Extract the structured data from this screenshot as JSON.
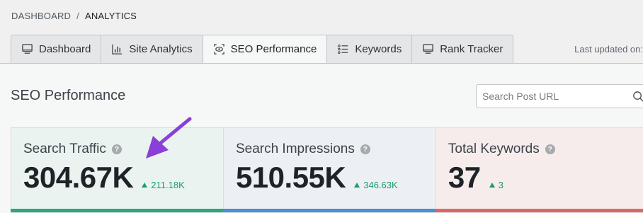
{
  "breadcrumb": {
    "root": "DASHBOARD",
    "separator": "/",
    "current": "ANALYTICS"
  },
  "tabs": [
    {
      "label": "Dashboard",
      "icon": "monitor-icon",
      "active": false
    },
    {
      "label": "Site Analytics",
      "icon": "bar-chart-icon",
      "active": false
    },
    {
      "label": "SEO Performance",
      "icon": "eye-scan-icon",
      "active": true
    },
    {
      "label": "Keywords",
      "icon": "list-icon",
      "active": false
    },
    {
      "label": "Rank Tracker",
      "icon": "monitor-icon",
      "active": false
    }
  ],
  "last_updated": {
    "label": "Last updated on:"
  },
  "page": {
    "title": "SEO Performance"
  },
  "search": {
    "placeholder": "Search Post URL",
    "icon": "search-icon"
  },
  "cards": [
    {
      "label": "Search Traffic",
      "value": "304.67K",
      "change": "211.18K",
      "bar_color": "#2aa77b"
    },
    {
      "label": "Search Impressions",
      "value": "510.55K",
      "change": "346.63K",
      "bar_color": "#4a8fd9"
    },
    {
      "label": "Total Keywords",
      "value": "37",
      "change": "3",
      "bar_color": "#e06565"
    }
  ],
  "annotation": {
    "icon": "arrow-annotation-icon",
    "color": "#8a3fd8"
  }
}
